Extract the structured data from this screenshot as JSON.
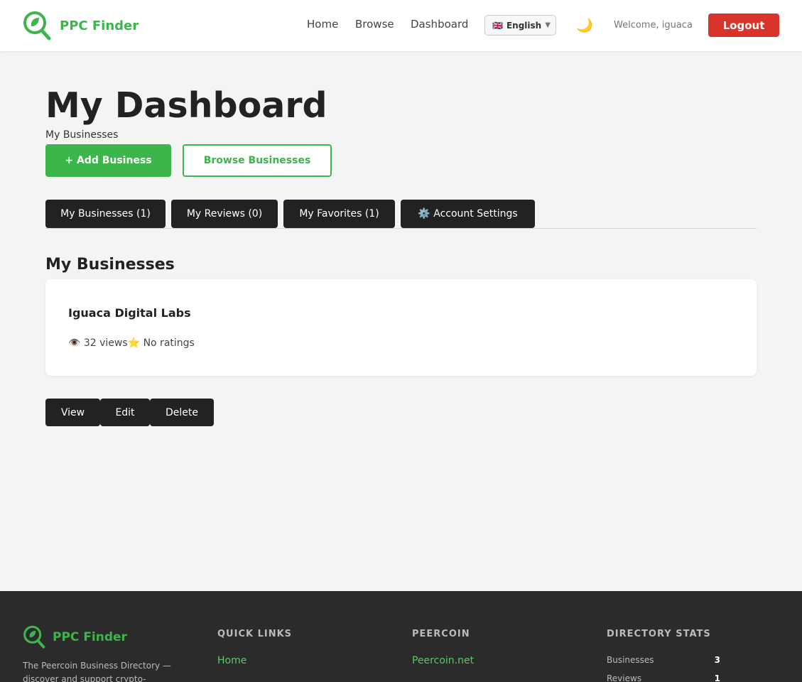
{
  "header": {
    "brand": "PPC Finder",
    "nav": [
      "Home",
      "Browse",
      "Dashboard"
    ],
    "language": "English",
    "language_flag": "🇬🇧",
    "welcome": "Welcome, iguaca",
    "logout_label": "Logout",
    "theme_icon": "🌙"
  },
  "main": {
    "title": "My Dashboard",
    "subtitle": "My Businesses",
    "add_label": "+ Add Business",
    "browse_label": "Browse Businesses",
    "tabs": [
      {
        "label": "My Businesses (1)"
      },
      {
        "label": "My Reviews (0)"
      },
      {
        "label": "My Favorites (1)"
      },
      {
        "label": "⚙️ Account Settings"
      }
    ],
    "section_title": "My Businesses",
    "business": {
      "name": "Iguaca Digital Labs",
      "views": "👁️ 32 views",
      "rating": "⭐ No ratings"
    },
    "actions": [
      "View",
      "Edit",
      "Delete"
    ]
  },
  "footer": {
    "brand": "PPC Finder",
    "description": "The Peercoin Business Directory — discover and support crypto-",
    "quick_links_heading": "QUICK LINKS",
    "quick_links": [
      "Home"
    ],
    "peercoin_heading": "PEERCOIN",
    "peercoin_links": [
      "Peercoin.net"
    ],
    "stats_heading": "DIRECTORY STATS",
    "stats": [
      {
        "label": "Businesses",
        "value": "3"
      },
      {
        "label": "Reviews",
        "value": "1"
      }
    ]
  },
  "colors": {
    "accent": "#3cb54a",
    "danger": "#d9342b",
    "dark": "#222222",
    "footer": "#2b2b2b"
  }
}
